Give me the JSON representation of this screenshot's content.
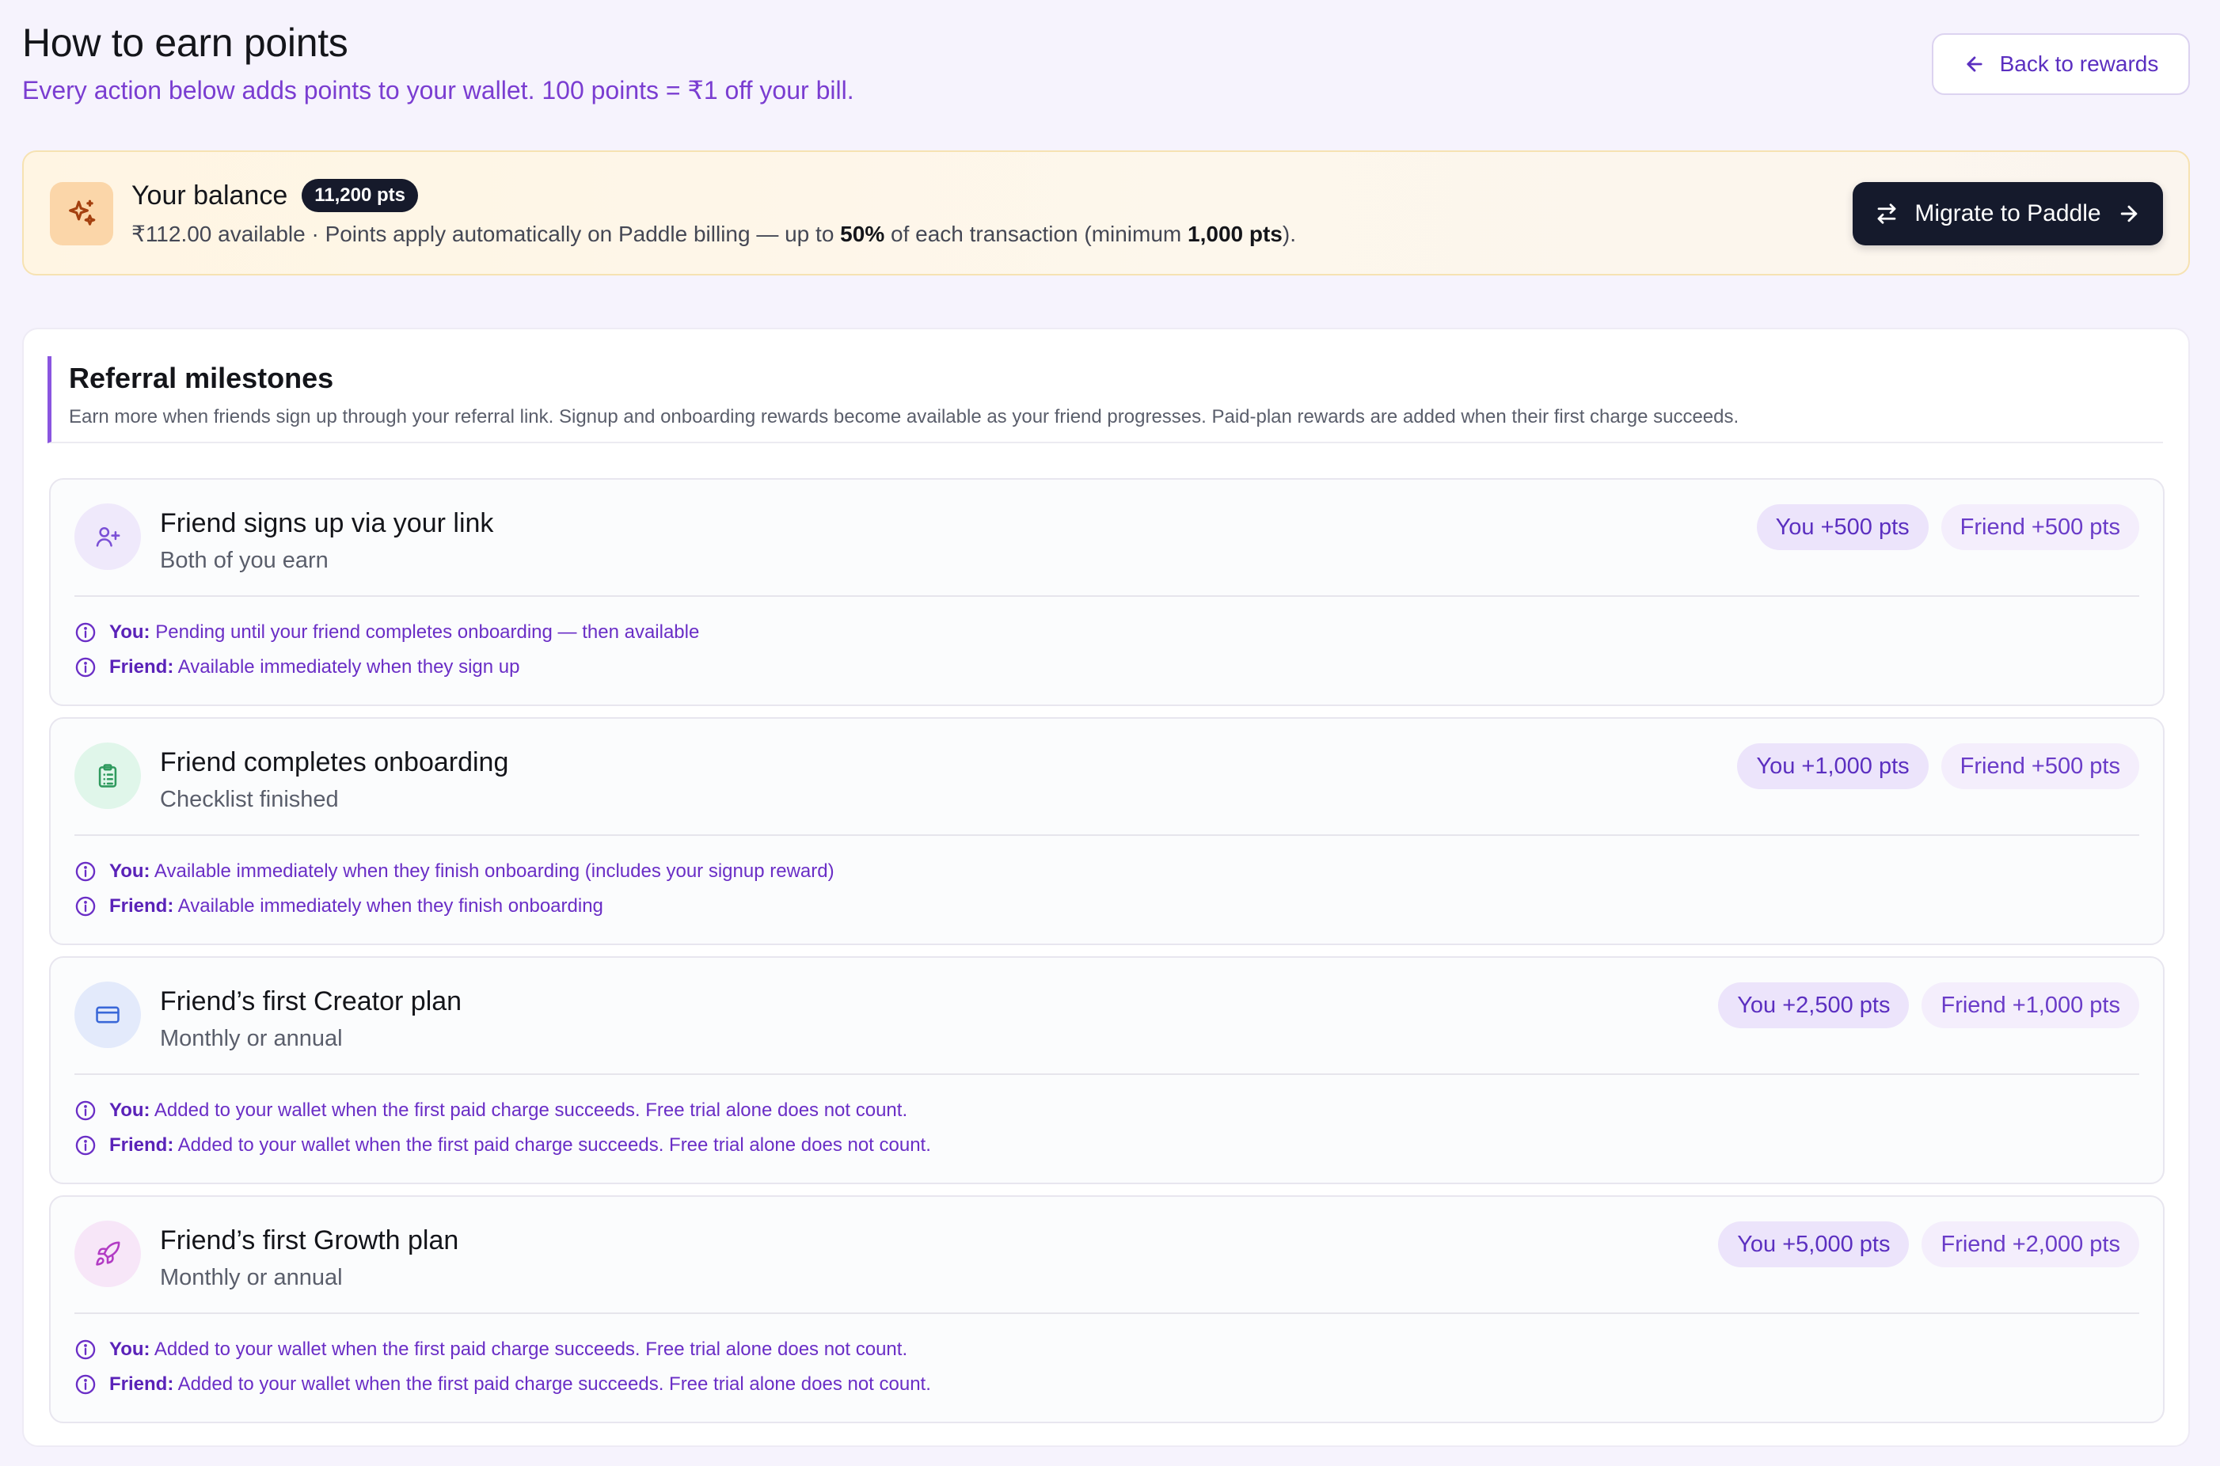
{
  "header": {
    "title": "How to earn points",
    "subtitle": "Every action below adds points to your wallet. 100 points = ₹1 off your bill.",
    "back_label": "Back to rewards"
  },
  "balance": {
    "title": "Your balance",
    "badge": "11,200 pts",
    "desc_prefix": "₹112.00 available · Points apply automatically on Paddle billing — up to ",
    "percent": "50%",
    "desc_middle": " of each transaction (minimum ",
    "minimum": "1,000 pts",
    "desc_suffix": ").",
    "migrate_label": "Migrate to Paddle",
    "icon": "sparkles-icon"
  },
  "referral": {
    "title": "Referral milestones",
    "description": "Earn more when friends sign up through your referral link. Signup and onboarding rewards become available as your friend progresses. Paid-plan rewards are added when their first charge succeeds.",
    "you_label": "You:",
    "friend_label": "Friend:",
    "milestones": [
      {
        "title": "Friend signs up via your link",
        "subtitle": "Both of you earn",
        "you_pts": "You +500 pts",
        "friend_pts": "Friend +500 pts",
        "you_note": "Pending until your friend completes onboarding — then available",
        "friend_note": "Available immediately when they sign up",
        "icon": "user-plus-icon",
        "icon_bg": "#efe9fb",
        "icon_color": "#7a4fd6"
      },
      {
        "title": "Friend completes onboarding",
        "subtitle": "Checklist finished",
        "you_pts": "You +1,000 pts",
        "friend_pts": "Friend +500 pts",
        "you_note": "Available immediately when they finish onboarding (includes your signup reward)",
        "friend_note": "Available immediately when they finish onboarding",
        "icon": "clipboard-list-icon",
        "icon_bg": "#e0f6ea",
        "icon_color": "#2f9a5e"
      },
      {
        "title": "Friend’s first Creator plan",
        "subtitle": "Monthly or annual",
        "you_pts": "You +2,500 pts",
        "friend_pts": "Friend +1,000 pts",
        "you_note": "Added to your wallet when the first paid charge succeeds. Free trial alone does not count.",
        "friend_note": "Added to your wallet when the first paid charge succeeds. Free trial alone does not count.",
        "icon": "credit-card-icon",
        "icon_bg": "#e3eafb",
        "icon_color": "#3a68d8"
      },
      {
        "title": "Friend’s first Growth plan",
        "subtitle": "Monthly or annual",
        "you_pts": "You +5,000 pts",
        "friend_pts": "Friend +2,000 pts",
        "you_note": "Added to your wallet when the first paid charge succeeds. Free trial alone does not count.",
        "friend_note": "Added to your wallet when the first paid charge succeeds. Free trial alone does not count.",
        "icon": "rocket-icon",
        "icon_bg": "#f7e6f8",
        "icon_color": "#b23bc4"
      }
    ]
  }
}
